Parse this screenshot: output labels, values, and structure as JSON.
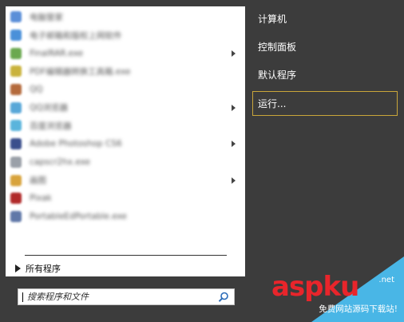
{
  "programs": [
    {
      "label": "电脑管家",
      "icon_color": "#5b8fd8",
      "has_submenu": false
    },
    {
      "label": "电子邮箱和版权上网软件",
      "icon_color": "#4a90d9",
      "has_submenu": false
    },
    {
      "label": "FinalRAR.exe",
      "icon_color": "#6aa84f",
      "has_submenu": true
    },
    {
      "label": "PDF编辑器转换工具箱.exe",
      "icon_color": "#c9b23c",
      "has_submenu": false
    },
    {
      "label": "QQ",
      "icon_color": "#b46a3c",
      "has_submenu": false
    },
    {
      "label": "QQ浏览器",
      "icon_color": "#58a7d8",
      "has_submenu": true
    },
    {
      "label": "百度浏览器",
      "icon_color": "#5ab4dc",
      "has_submenu": false
    },
    {
      "label": "Adobe Photoshop CS6",
      "icon_color": "#3a4f8c",
      "has_submenu": true
    },
    {
      "label": "capscr2hx.exe",
      "icon_color": "#9aa0a8",
      "has_submenu": false
    },
    {
      "label": "画图",
      "icon_color": "#d8a33c",
      "has_submenu": true
    },
    {
      "label": "Pixak",
      "icon_color": "#b02a2a",
      "has_submenu": false
    },
    {
      "label": "PortableEdPortable.exe",
      "icon_color": "#6078a8",
      "has_submenu": false
    }
  ],
  "all_programs": {
    "label": "所有程序"
  },
  "search": {
    "placeholder": "搜索程序和文件"
  },
  "right_menu": [
    {
      "label": "计算机"
    },
    {
      "label": "控制面板"
    },
    {
      "label": "默认程序"
    },
    {
      "label": "运行..."
    }
  ],
  "colors": {
    "selection_border": "#c9a63a",
    "pane_background": "#3c3c3c"
  },
  "watermark": {
    "logo": "aspku",
    "domain": ".net",
    "slogan": "免费网站源码下载站!"
  }
}
